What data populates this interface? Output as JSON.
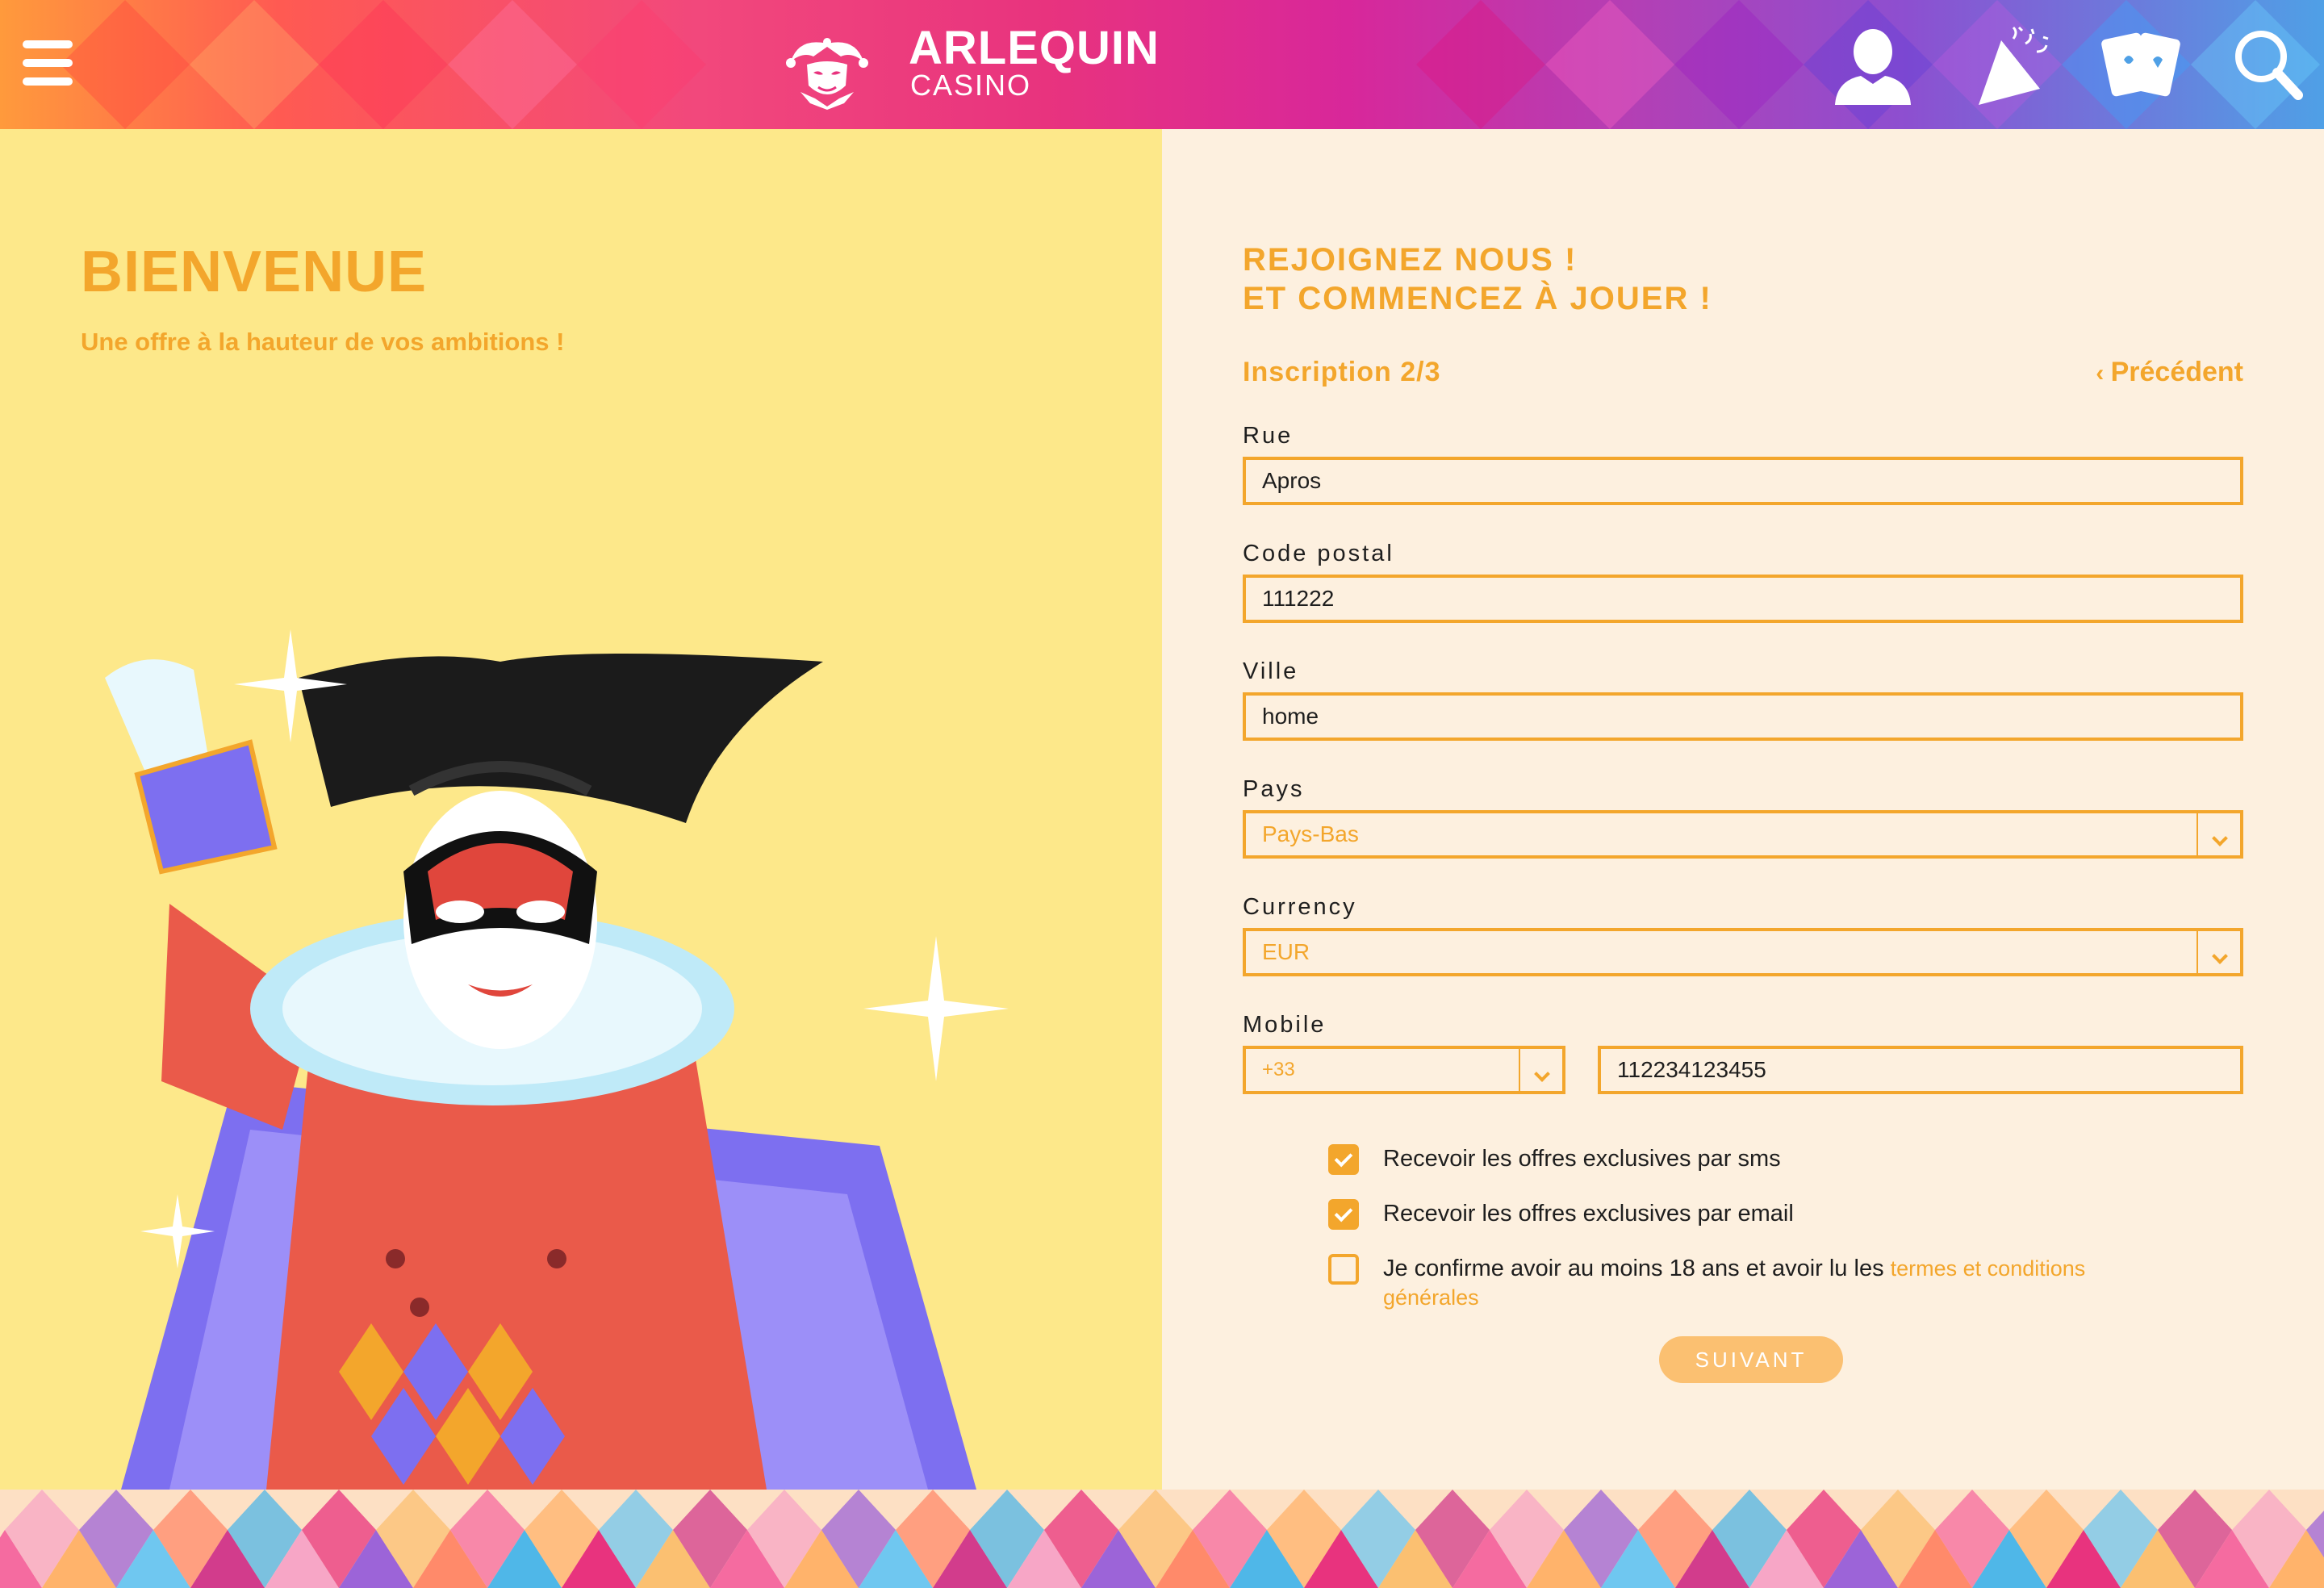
{
  "header": {
    "logo_title": "ARLEQUIN",
    "logo_subtitle": "CASINO",
    "icons": [
      "menu-icon",
      "user-icon",
      "promotions-icon",
      "cards-icon",
      "search-icon"
    ]
  },
  "left": {
    "title": "BIENVENUE",
    "subtitle": "Une offre à la hauteur de vos ambitions !"
  },
  "form": {
    "title_line1": "REJOIGNEZ NOUS !",
    "title_line2": "ET COMMENCEZ À JOUER !",
    "step": "Inscription 2/3",
    "prev": "Précédent",
    "fields": {
      "street": {
        "label": "Rue",
        "value": "Apros"
      },
      "postal": {
        "label": "Code postal",
        "value": "111222"
      },
      "city": {
        "label": "Ville",
        "value": "home"
      },
      "country": {
        "label": "Pays",
        "value": "Pays-Bas"
      },
      "currency": {
        "label": "Currency",
        "value": "EUR"
      },
      "mobile": {
        "label": "Mobile",
        "prefix": "+33",
        "value": "112234123455"
      }
    },
    "checkboxes": {
      "sms": {
        "label": "Recevoir les offres exclusives par sms",
        "checked": true
      },
      "email": {
        "label": "Recevoir les offres exclusives par email",
        "checked": true
      },
      "terms": {
        "label": "Je confirme avoir au moins 18 ans et avoir lu les ",
        "link": "termes et conditions générales",
        "checked": false
      }
    },
    "submit": "SUIVANT"
  },
  "colors": {
    "accent": "#f3a62c",
    "left_bg": "#fde88a",
    "right_bg": "#fdf0df",
    "button": "#fbc071"
  }
}
